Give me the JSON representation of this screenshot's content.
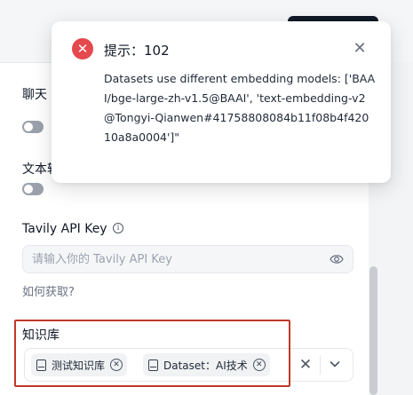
{
  "settings": {
    "chat_label": "聊天",
    "text_label": "文本转",
    "tavily": {
      "label": "Tavily API Key",
      "info_icon": "info-circle-icon",
      "placeholder": "请输入你的 Tavily API Key",
      "visibility_icon": "eye-icon",
      "help_link": "如何获取?"
    },
    "knowledge_base": {
      "label": "知识库",
      "tags": [
        {
          "label": "测试知识库",
          "icon": "book-icon"
        },
        {
          "label": "Dataset：AI技术",
          "icon": "book-icon"
        }
      ]
    }
  },
  "notification": {
    "icon": "error-icon",
    "title": "提示：102",
    "message": "Datasets use different embedding models: ['BAAI/bge-large-zh-v1.5@BAAI', 'text-embedding-v2@Tongyi-Qianwen#41758808084b11f08b4f42010a8a0004']\"",
    "colors": {
      "error": "#e5484d",
      "highlight": "#c0392b"
    }
  }
}
